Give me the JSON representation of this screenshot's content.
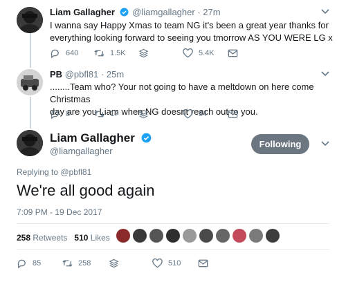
{
  "tweets": [
    {
      "name": "Liam Gallagher",
      "handle": "@liamgallagher",
      "dot": "·",
      "time": "27m",
      "text_line1": "I wanna say Happy Xmas to team NG it's been a great year thanks for",
      "text_line2": "everything looking forward to seeing you tmorrow AS YOU WERE LG x",
      "replies": "640",
      "retweets": "1.5K",
      "likes": "5.4K"
    },
    {
      "name": "PB",
      "handle": "@pbfl81",
      "dot": "·",
      "time": "25m",
      "text_line1": "........Team who?  Your not going to have a meltdown on here come Christmas",
      "text_line2": "day are you Liam when NG doesnt reach out to you.",
      "replies": "8",
      "retweets": "17",
      "likes": "54"
    }
  ],
  "main": {
    "name": "Liam Gallagher",
    "handle": "@liamgallagher",
    "follow_label": "Following",
    "replying_to": "Replying to @pbfl81",
    "text": "We're all good again",
    "timestamp": "7:09 PM - 19 Dec 2017",
    "retweets_count": "258",
    "retweets_label": "Retweets",
    "likes_count": "510",
    "likes_label": "Likes",
    "replies": "85",
    "retweets": "258",
    "likes": "510"
  },
  "icons": [
    "reply-icon",
    "retweet-icon",
    "stack-icon",
    "heart-icon",
    "message-icon",
    "verified-icon",
    "chevron-down-icon"
  ],
  "colors": {
    "verified": "#1da1f2",
    "follow_button": "#6b7680",
    "secondary_text": "#657786"
  }
}
